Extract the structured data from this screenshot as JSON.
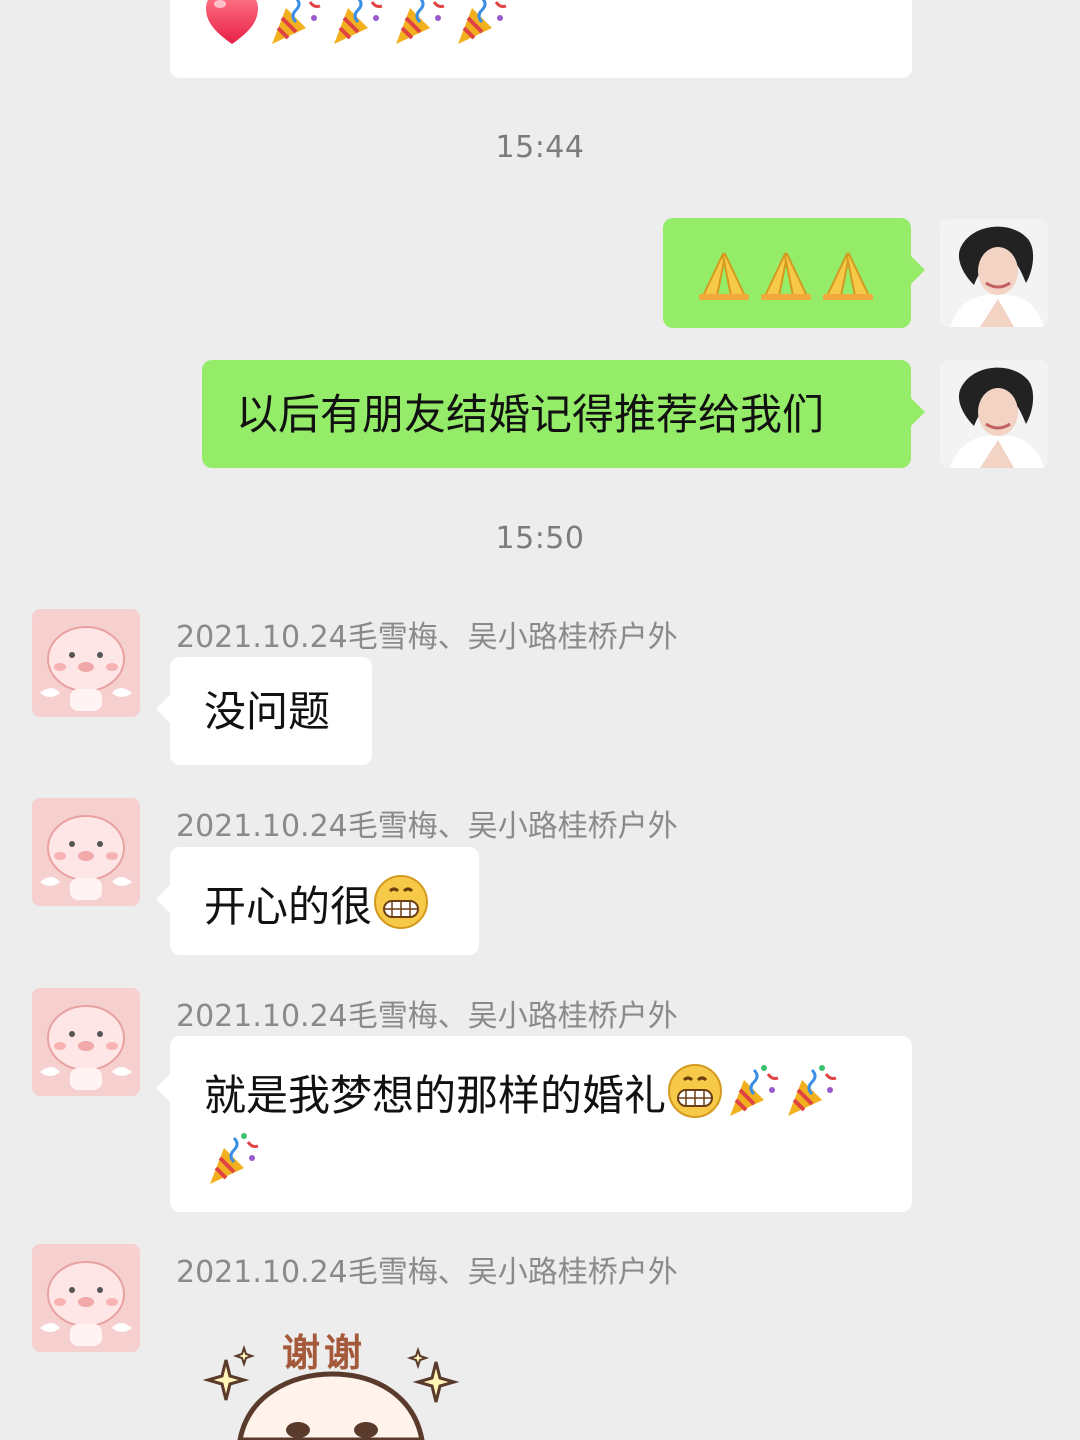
{
  "messages": {
    "time_1": "15:44",
    "time_2": "15:50",
    "outgoing_2_text": "以后有朋友结婚记得推荐给我们",
    "sender_name": "2021.10.24毛雪梅、吴小路桂桥户外",
    "incoming_1_text": "没问题",
    "incoming_2_text": "开心的很",
    "incoming_3_text": "就是我梦想的那样的婚礼",
    "sticker_text": "谢谢"
  },
  "icons": {
    "heart": "heart-icon",
    "party_popper": "party-popper-icon",
    "prayer_hands": "prayer-hands-icon",
    "grinning_face": "grinning-face-icon"
  },
  "colors": {
    "background": "#ededed",
    "incoming_bubble": "#ffffff",
    "outgoing_bubble": "#95ec69",
    "meta_text": "#8a8a8a"
  }
}
